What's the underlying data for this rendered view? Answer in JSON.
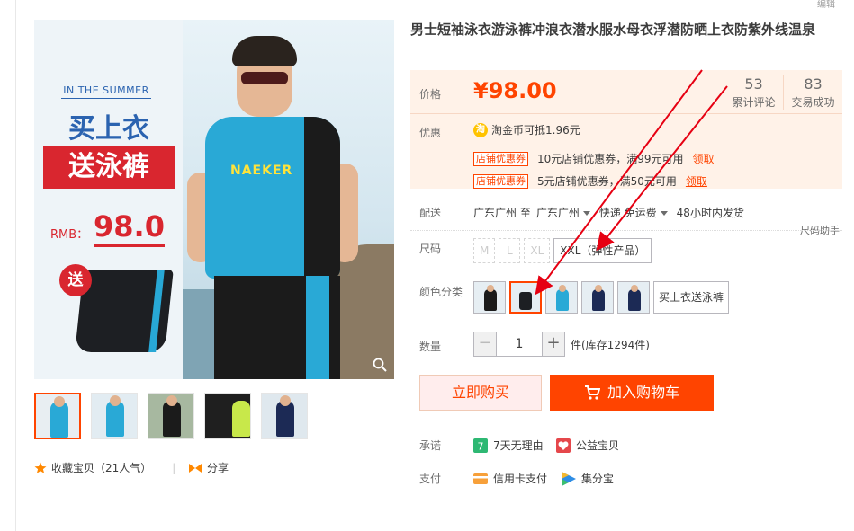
{
  "top_edit": "编辑",
  "main_image": {
    "badge": "IN THE SUMMER",
    "headline": "买上衣",
    "gift_headline": "送泳裤",
    "rmb_label": "RMB：",
    "rmb_value": "98.0",
    "gift_circle": "送",
    "shirt_brand": "NAEKER"
  },
  "thumbnail_count": 5,
  "favorite": {
    "label": "收藏宝贝（21人气）",
    "share": "分享"
  },
  "product": {
    "title": "男士短袖泳衣游泳裤冲浪衣潜水服水母衣浮潜防晒上衣防紫外线温泉",
    "price_label": "价格",
    "price": "¥98.00",
    "stats": [
      {
        "num": "53",
        "label": "累计评论"
      },
      {
        "num": "83",
        "label": "交易成功"
      }
    ],
    "promo_label": "优惠",
    "coin_icon": "淘",
    "coin_text": "淘金币可抵1.96元",
    "coupons": [
      {
        "tag": "店铺优惠券",
        "text": "10元店铺优惠券，满99元可用",
        "link": "领取"
      },
      {
        "tag": "店铺优惠券",
        "text": "5元店铺优惠券，满50元可用",
        "link": "领取"
      }
    ],
    "shipping_label": "配送",
    "ship_from": "广东广州 至",
    "ship_to": "广东广州",
    "ship_fee": "快递 免运费",
    "ship_time": "48小时内发货",
    "size_help": "尺码助手",
    "size_label": "尺码",
    "sizes": [
      {
        "label": "M",
        "disabled": true
      },
      {
        "label": "L",
        "disabled": true
      },
      {
        "label": "XL",
        "disabled": true
      },
      {
        "label": "XXL（弹性产品）",
        "disabled": false
      }
    ],
    "color_label": "颜色分类",
    "color_text_option": "买上衣送泳裤",
    "qty_label": "数量",
    "qty_minus": "−",
    "qty_value": "1",
    "qty_plus": "+",
    "stock": "件(库存1294件)",
    "buy_now": "立即购买",
    "add_cart": "加入购物车",
    "promise_label": "承诺",
    "promise_items": [
      "7天无理由",
      "公益宝贝"
    ],
    "pay_label": "支付",
    "pay_items": [
      "信用卡支付",
      "集分宝"
    ]
  },
  "colors": {
    "accent": "#ff4400",
    "price_bg": "#fff2e8"
  }
}
